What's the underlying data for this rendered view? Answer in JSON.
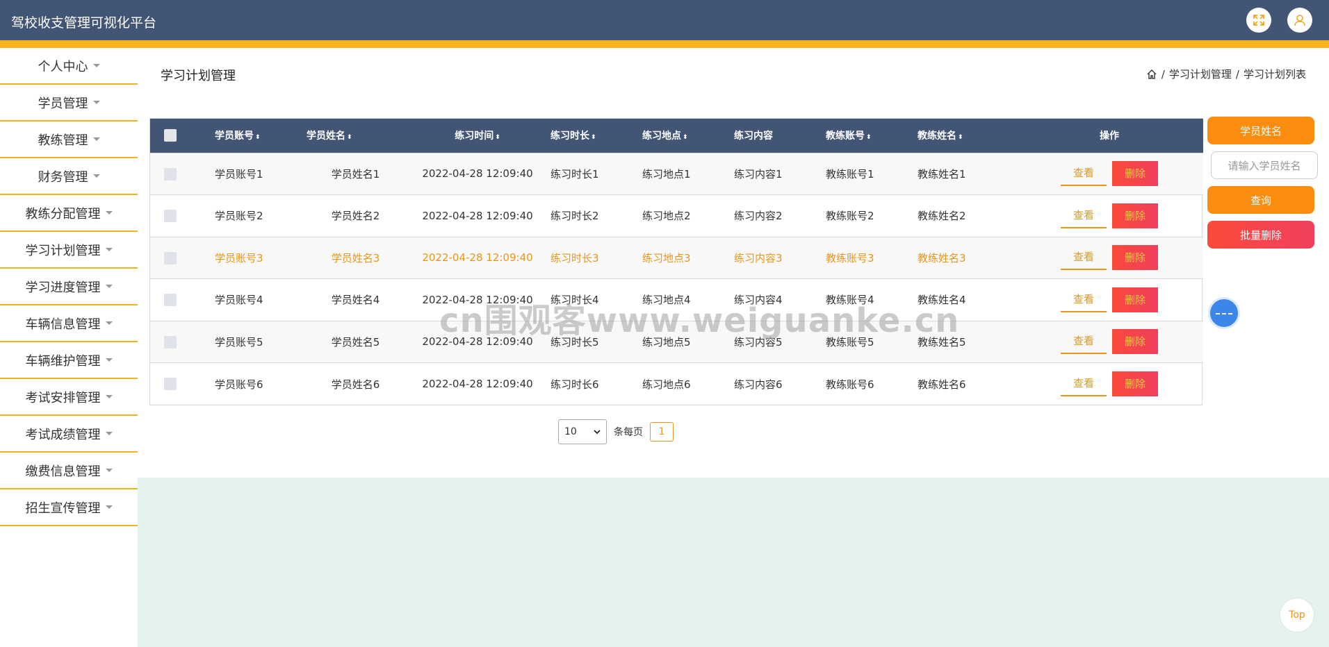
{
  "app": {
    "title": "驾校收支管理可视化平台"
  },
  "header": {
    "fullscreen_icon": "fullscreen-icon",
    "user_icon": "user-icon"
  },
  "sidebar": {
    "items": [
      {
        "label": "个人中心"
      },
      {
        "label": "学员管理"
      },
      {
        "label": "教练管理"
      },
      {
        "label": "财务管理"
      },
      {
        "label": "教练分配管理"
      },
      {
        "label": "学习计划管理"
      },
      {
        "label": "学习进度管理"
      },
      {
        "label": "车辆信息管理"
      },
      {
        "label": "车辆维护管理"
      },
      {
        "label": "考试安排管理"
      },
      {
        "label": "考试成绩管理"
      },
      {
        "label": "缴费信息管理"
      },
      {
        "label": "招生宣传管理"
      }
    ]
  },
  "main": {
    "page_title": "学习计划管理",
    "breadcrumb": [
      "学习计划管理",
      "学习计划列表"
    ],
    "breadcrumb_sep": "/"
  },
  "table": {
    "columns": [
      "学员账号",
      "学员姓名",
      "练习时间",
      "练习时长",
      "练习地点",
      "练习内容",
      "教练账号",
      "教练姓名",
      "操作"
    ],
    "sort_glyph": "⬍",
    "view_label": "查看",
    "delete_label": "删除",
    "rows": [
      [
        "学员账号1",
        "学员姓名1",
        "2022-04-28 12:09:40",
        "练习时长1",
        "练习地点1",
        "练习内容1",
        "教练账号1",
        "教练姓名1"
      ],
      [
        "学员账号2",
        "学员姓名2",
        "2022-04-28 12:09:40",
        "练习时长2",
        "练习地点2",
        "练习内容2",
        "教练账号2",
        "教练姓名2"
      ],
      [
        "学员账号3",
        "学员姓名3",
        "2022-04-28 12:09:40",
        "练习时长3",
        "练习地点3",
        "练习内容3",
        "教练账号3",
        "教练姓名3"
      ],
      [
        "学员账号4",
        "学员姓名4",
        "2022-04-28 12:09:40",
        "练习时长4",
        "练习地点4",
        "练习内容4",
        "教练账号4",
        "教练姓名4"
      ],
      [
        "学员账号5",
        "学员姓名5",
        "2022-04-28 12:09:40",
        "练习时长5",
        "练习地点5",
        "练习内容5",
        "教练账号5",
        "教练姓名5"
      ],
      [
        "学员账号6",
        "学员姓名6",
        "2022-04-28 12:09:40",
        "练习时长6",
        "练习地点6",
        "练习内容6",
        "教练账号6",
        "教练姓名6"
      ]
    ],
    "highlight_row": 2
  },
  "pagination": {
    "page_size": "10",
    "per_page_label": "条每页",
    "current_page": "1"
  },
  "search_panel": {
    "field_label": "学员姓名",
    "placeholder": "请输入学员姓名",
    "query_label": "查询",
    "batch_delete_label": "批量删除"
  },
  "back_to_top": "Top",
  "watermark": "cn围观客www.weiguanke.cn",
  "colors": {
    "header": "#435575",
    "accent": "#f7b21c",
    "orange": "#fa8c10",
    "danger": "#f0405e"
  }
}
